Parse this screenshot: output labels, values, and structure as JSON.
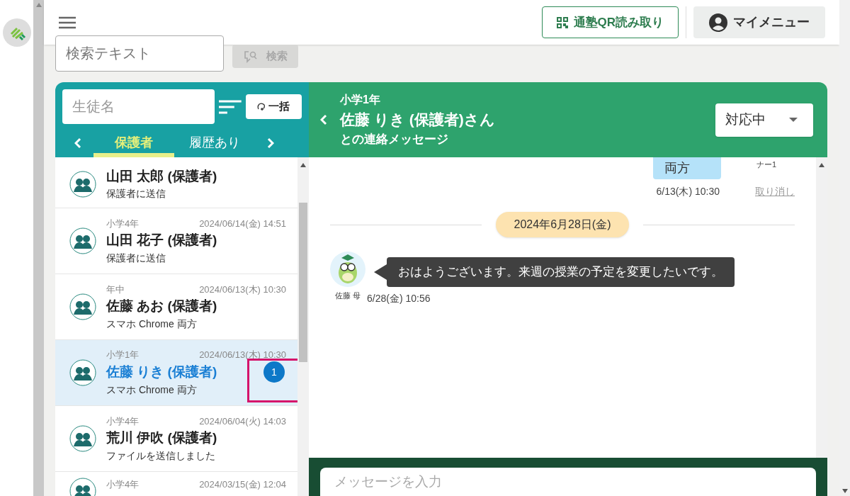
{
  "header": {
    "qr_button": "通塾QR読み取り",
    "my_menu": "マイメニュー"
  },
  "search": {
    "placeholder": "検索テキスト",
    "button": "検索",
    "button_disabled": true
  },
  "student_panel": {
    "name_placeholder": "生徒名",
    "bulk_button": "一括",
    "tabs": [
      {
        "label": "保護者",
        "selected": true
      },
      {
        "label": "履歴あり",
        "selected": false
      }
    ],
    "items": [
      {
        "name": "山田 太郎 (保護者)",
        "preview": "保護者に送信",
        "selected": false
      },
      {
        "grade": "小学4年",
        "time": "2024/06/14(金) 14:51",
        "name": "山田 花子 (保護者)",
        "preview": "保護者に送信",
        "selected": false
      },
      {
        "grade": "年中",
        "time": "2024/06/13(木) 10:30",
        "name": "佐藤 あお (保護者)",
        "preview": "スマホ Chrome 両方",
        "selected": false
      },
      {
        "grade": "小学1年",
        "time": "2024/06/13(木) 10:30",
        "name": "佐藤 りき (保護者)",
        "preview": "スマホ Chrome 両方",
        "selected": true,
        "unread": "1"
      },
      {
        "grade": "小学4年",
        "time": "2024/06/04(火) 14:03",
        "name": "荒川 伊吹 (保護者)",
        "preview": "ファイルを送信しました",
        "selected": false
      },
      {
        "grade": "小学4年",
        "time": "2024/03/15(金) 12:04",
        "selected": false
      }
    ]
  },
  "chat": {
    "grade": "小学1年",
    "title": "佐藤 りき (保護者)さん",
    "subtitle": "との連絡メッセージ",
    "status": "対応中",
    "sent": {
      "text": "両方",
      "sender_fragment": "ナー1",
      "time": "6/13(木) 10:30",
      "cancel": "取り消し"
    },
    "date_divider": "2024年6月28日(金)",
    "received": {
      "sender": "佐藤 母",
      "text": "おはようございます。来週の授業の予定を変更したいです。",
      "time": "6/28(金) 10:56"
    },
    "composer_placeholder": "メッセージを入力"
  }
}
